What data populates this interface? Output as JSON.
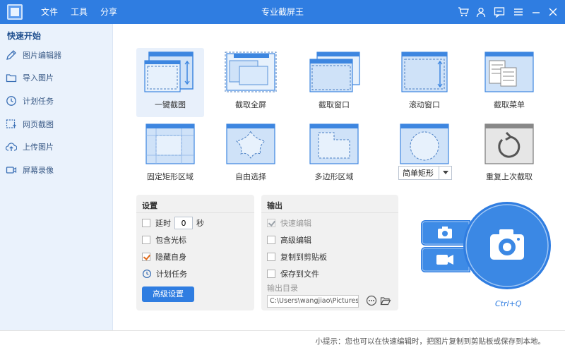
{
  "titlebar": {
    "title": "专业截屏王",
    "menus": [
      "文件",
      "工具",
      "分享"
    ],
    "icons": [
      "logo-icon",
      "cart-icon",
      "user-icon",
      "message-icon",
      "menu-icon",
      "minimize-icon",
      "close-icon"
    ],
    "bg_color": "#2f7de1"
  },
  "sidebar": {
    "heading": "快速开始",
    "items": [
      {
        "label": "图片编辑器",
        "icon": "pencil-icon"
      },
      {
        "label": "导入图片",
        "icon": "folder-icon"
      },
      {
        "label": "计划任务",
        "icon": "clock-icon"
      },
      {
        "label": "网页截图",
        "icon": "webpage-capture-icon"
      },
      {
        "label": "上传图片",
        "icon": "cloud-upload-icon"
      },
      {
        "label": "屏幕录像",
        "icon": "video-camera-icon"
      }
    ]
  },
  "modes": {
    "row1": [
      "一键截图",
      "截取全屏",
      "截取窗口",
      "滚动窗口",
      "截取菜单"
    ],
    "row2": [
      "固定矩形区域",
      "自由选择",
      "多边形区域",
      "",
      "重复上次截取"
    ],
    "shape_select_value": "简单矩形"
  },
  "settings": {
    "title": "设置",
    "delay_label": "延时",
    "delay_value": "0",
    "delay_unit": "秒",
    "include_cursor": "包含光标",
    "hide_self": "隐藏自身",
    "schedule": "计划任务",
    "advanced_button": "高级设置"
  },
  "output": {
    "title": "输出",
    "quick_edit": "快速编辑",
    "advanced_edit": "高级编辑",
    "copy_clipboard": "复制到剪贴板",
    "save_file": "保存到文件",
    "dir_label": "输出目录",
    "dir_value": "C:\\Users\\wangjiao\\Pictures\\A"
  },
  "capture": {
    "hotkey": "Ctrl+Q"
  },
  "status": {
    "tip": "小提示：您也可以在快速编辑时，把图片复制到剪贴板或保存到本地。"
  },
  "colors": {
    "accent": "#2f7de1",
    "sidebar_bg": "#eaf2fc",
    "panel_bg": "#f1f1f1",
    "check_mark": "#e06a1a"
  }
}
